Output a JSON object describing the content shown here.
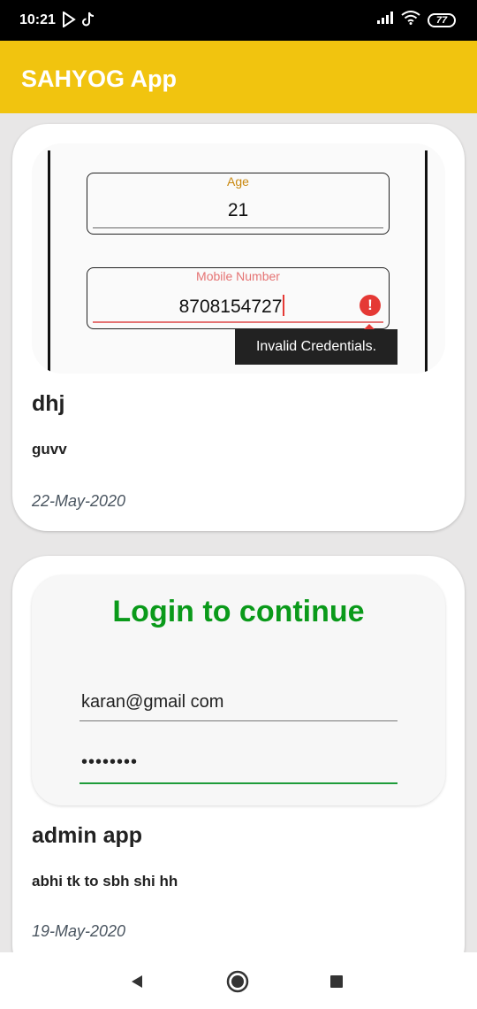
{
  "status_bar": {
    "time": "10:21",
    "battery": "77"
  },
  "app_bar": {
    "title": "SAHYOG App"
  },
  "posts": [
    {
      "title": "dhj",
      "body": "guvv",
      "date": "22-May-2020",
      "screenshot": {
        "age_label": "Age",
        "age_value": "21",
        "mobile_label": "Mobile Number",
        "mobile_value": "8708154727",
        "error_tooltip": "Invalid Credentials."
      }
    },
    {
      "title": "admin app",
      "body": "abhi tk to sbh shi hh",
      "date": "19-May-2020",
      "screenshot": {
        "heading": "Login to continue",
        "email_value": "karan@gmail com",
        "password_value": "••••••••"
      }
    }
  ],
  "colors": {
    "app_bar": "#f1c40f",
    "login_heading": "#0a9a1a",
    "error": "#e53935"
  }
}
